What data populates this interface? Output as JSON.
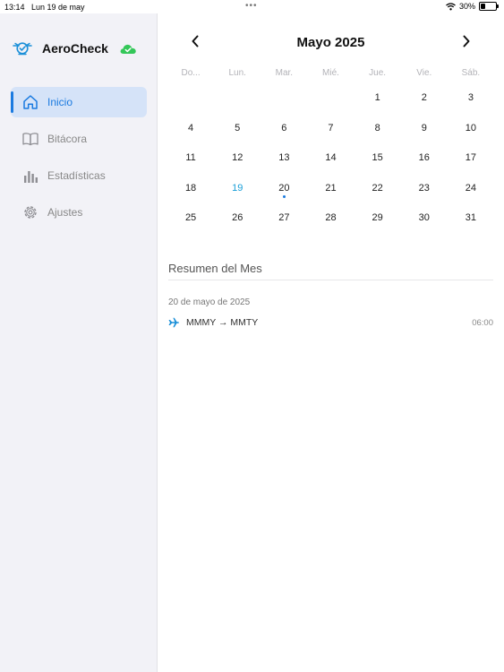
{
  "status_bar": {
    "time": "13:14",
    "date": "Lun 19 de may",
    "battery_text": "30%",
    "battery_level": 0.3
  },
  "app": {
    "name": "AeroCheck"
  },
  "nav": [
    {
      "label": "Inicio",
      "icon": "home-icon",
      "active": true
    },
    {
      "label": "Bitácora",
      "icon": "book-icon",
      "active": false
    },
    {
      "label": "Estadísticas",
      "icon": "bar-chart-icon",
      "active": false
    },
    {
      "label": "Ajustes",
      "icon": "gear-icon",
      "active": false
    }
  ],
  "calendar": {
    "month_label": "Mayo 2025",
    "weekdays": [
      "Do...",
      "Lun.",
      "Mar.",
      "Mié.",
      "Jue.",
      "Vie.",
      "Sáb."
    ],
    "first_weekday_index": 4,
    "days_in_month": 31,
    "today": 19,
    "event_days": [
      20
    ]
  },
  "summary": {
    "title": "Resumen del Mes",
    "entry_date": "20 de mayo de 2025",
    "flights": [
      {
        "route": "MMMY → MMTY",
        "time": "06:00"
      }
    ]
  },
  "colors": {
    "accent": "#1a7ae0",
    "today": "#1a9fd8",
    "sidebar_bg": "#f2f2f7",
    "active_bg": "#d5e3f8",
    "cloud": "#34c759"
  }
}
